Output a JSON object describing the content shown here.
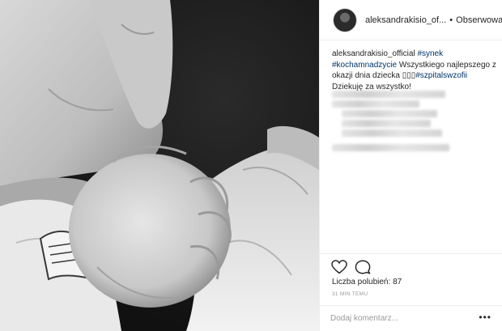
{
  "post": {
    "username": "aleksandrakisio_of...",
    "separator": "•",
    "follow_label": "Obserwowanie",
    "caption": {
      "author": "aleksandrakisio_official",
      "tag_synek": "#synek",
      "tag_kocham": "#kochamnadzycie",
      "text_main": "Wszystkiego najlepszego z okazji dnia dziecka",
      "emoji_boxes": "▯▯▯",
      "tag_szpital": "#szpitalswzofii",
      "text_thanks": "Dziekuję za wszystko!"
    },
    "likes_label": "Liczba polubień:",
    "likes_count": "87",
    "timestamp": "31 MIN TEMU",
    "comment_placeholder": "Dodaj komentarz...",
    "more_label": "•••",
    "icons": {
      "like": "heart-icon",
      "comment": "comment-icon",
      "more": "more-options-icon"
    },
    "colors": {
      "hashtag": "#003569",
      "muted": "#999999",
      "text": "#262626"
    }
  }
}
